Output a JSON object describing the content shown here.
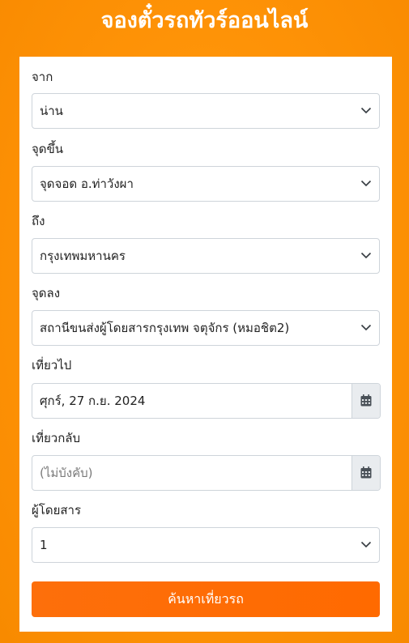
{
  "header": {
    "title": "จองตั๋วรถทัวร์ออนไลน์"
  },
  "form": {
    "origin": {
      "label": "จาก",
      "value": "น่าน"
    },
    "pickup": {
      "label": "จุดขึ้น",
      "value": "จุดจอด อ.ท่าวังผา"
    },
    "destination": {
      "label": "ถึง",
      "value": "กรุงเทพมหานคร"
    },
    "dropoff": {
      "label": "จุดลง",
      "value": "สถานีขนส่งผู้โดยสารกรุงเทพ จตุจักร (หมอชิต2)"
    },
    "departure": {
      "label": "เที่ยวไป",
      "value": "ศุกร์, 27 ก.ย. 2024"
    },
    "return": {
      "label": "เที่ยวกลับ",
      "placeholder": "(ไม่บังคับ)"
    },
    "passengers": {
      "label": "ผู้โดยสาร",
      "value": "1"
    },
    "submit_label": "ค้นหาเที่ยวรถ"
  },
  "icons": {
    "select_arrow": "chevron-down-icon",
    "date_picker": "calendar-icon"
  },
  "colors": {
    "background": "#ff9408",
    "button": "#fd6f0b",
    "card": "#ffffff",
    "addon": "#e9ecef"
  }
}
